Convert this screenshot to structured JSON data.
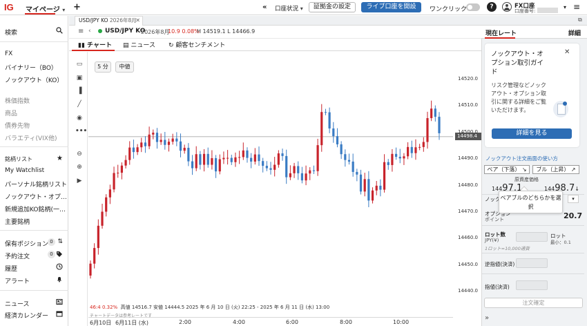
{
  "topbar": {
    "logo": "IG",
    "my_page": "マイページ",
    "add": "+",
    "arrows": "«",
    "account_status": "口座状況",
    "margin_setting": "証拠金の設定",
    "open_live": "ライブ口座を開設",
    "one_click": "ワンクリック",
    "help": "?",
    "account_name": "FX口座",
    "account_number_label": "口座番号:",
    "menu": "≡",
    "accent_color": "#d7261e",
    "primary_color": "#2d6db5"
  },
  "sidebar": {
    "search": "検索",
    "markets": [
      "FX",
      "バイナリー（BO）",
      "ノックアウト（KO）"
    ],
    "markets_disabled": [
      "株価指数",
      "商品",
      "債券先物",
      "バラエティ(VIX他)"
    ],
    "watchlists_title": "銘柄リスト",
    "watchlists": [
      "My Watchlist",
      "パーソナル銘柄リスト",
      "ノックアウト・オプ…",
      "新規追加KO銘柄(一…",
      "主要銘柄"
    ],
    "positions": {
      "label": "保有ポジション",
      "count": "0"
    },
    "orders": {
      "label": "予約注文",
      "count": "0"
    },
    "history": "履歴",
    "alerts": "アラート",
    "news": "ニュース",
    "calendar": "経済カレンダー"
  },
  "tab": {
    "symbol": "USD/JPY KO",
    "month": "2026年8月"
  },
  "header": {
    "symbol": "USD/JPY KO",
    "month": "2026年8月",
    "change": "10.9",
    "change_pct": "0.08%",
    "hl": "H 14519.1 L 14466.9"
  },
  "subtabs": {
    "chart": "チャート",
    "news": "ニュース",
    "sentiment": "顧客センチメント"
  },
  "chart_controls": {
    "interval": "5 分",
    "price_type": "中値"
  },
  "chart_info": {
    "line1_red": "46:4  0.32%",
    "line1": "高値 14516.7   安値 14444.5   2025 年 6 月 10 日 (火) 22:25 - 2025 年 6 月 11 日 (水) 13:00",
    "line2": "チャートデータは参考レートです"
  },
  "chart_data": {
    "type": "candlestick",
    "y_ticks": [
      "14520.0",
      "14510.0",
      "14500.0",
      "14490.0",
      "14480.0",
      "14470.0",
      "14460.0",
      "14450.0",
      "14440.0"
    ],
    "ylim": [
      14440.0,
      14520.0
    ],
    "x_ticks": [
      "6月10日",
      "6月11日 (水)",
      "2:00",
      "4:00",
      "6:00",
      "8:00",
      "10:00"
    ],
    "current_price": "14498.4",
    "closes": [
      14450.5,
      14456.4,
      14464.8,
      14470.1,
      14475.5,
      14478.5,
      14484.7,
      14484.8,
      14487.5,
      14489.6,
      14494.3,
      14492.6,
      14494.4,
      14496.2,
      14494.8,
      14499.2,
      14499.9,
      14496.4,
      14497.2,
      14495.3,
      14496.5,
      14497.7,
      14496.6,
      14493.1,
      14494.2,
      14489.1,
      14486.5,
      14491.8,
      14487.8,
      14491.9,
      14487.8,
      14490.3,
      14485.3,
      14489.9,
      14490.4,
      14490.4,
      14488.8,
      14490.6,
      14490.7,
      14493.2,
      14490.4,
      14489.0,
      14491.7,
      14489.2,
      14487.4,
      14486.5,
      14485.9,
      14487.8,
      14492.1,
      14491.1,
      14483.1,
      14484.6,
      14487.3,
      14484.6,
      14481.9,
      14484.5,
      14485.7,
      14485.4,
      14495.2,
      14507.7,
      14507.6,
      14501.5,
      14498.6,
      14495.5,
      14491.8,
      14489.6,
      14489.0,
      14485.1,
      14484.1,
      14477.7,
      14482.4,
      14474.3,
      14478.1,
      14479.9,
      14478.4,
      14488.8,
      14487.7,
      14491.9,
      14490.8,
      14490.2,
      14491.0,
      14494.5,
      14492.2,
      14494.4,
      14494.5,
      14496.4,
      14505.4,
      14509.0,
      14505.9,
      14499.7
    ]
  },
  "right_panel": {
    "tab_rates": "現在レート",
    "tab_detail": "詳細",
    "card_title": "ノックアウト・オプション取引ガイド",
    "card_body": "リスク管理などノックアウト・オプション取引に関する詳細をご覧いただけます。",
    "card_button": "詳細を見る",
    "ko_link": "ノックアウト注文画面の使い方",
    "bear": "ベア（下落）",
    "bull": "ブル（上昇）",
    "underlying": "原資産価格",
    "bear_price_small": "144",
    "bear_price_big": "97.1",
    "bull_price_small": "144",
    "bull_price_big": "98.7",
    "tooltip": "ベアブルのどちらかを選択",
    "knockout_label": "ノック",
    "distance_label": "オプション",
    "distance_sub": "ポイント",
    "distance_value": "20.7",
    "lot_label": "ロット数",
    "lot_unit": "JPY(¥)",
    "lot_right": "ロット",
    "lot_min": "最小：0.1",
    "lot_hint": "1ロット=10,000通貨",
    "stop_label": "逆指値(決済)",
    "limit_label": "指値(決済)",
    "confirm": "注文確定",
    "collapse": "»"
  }
}
